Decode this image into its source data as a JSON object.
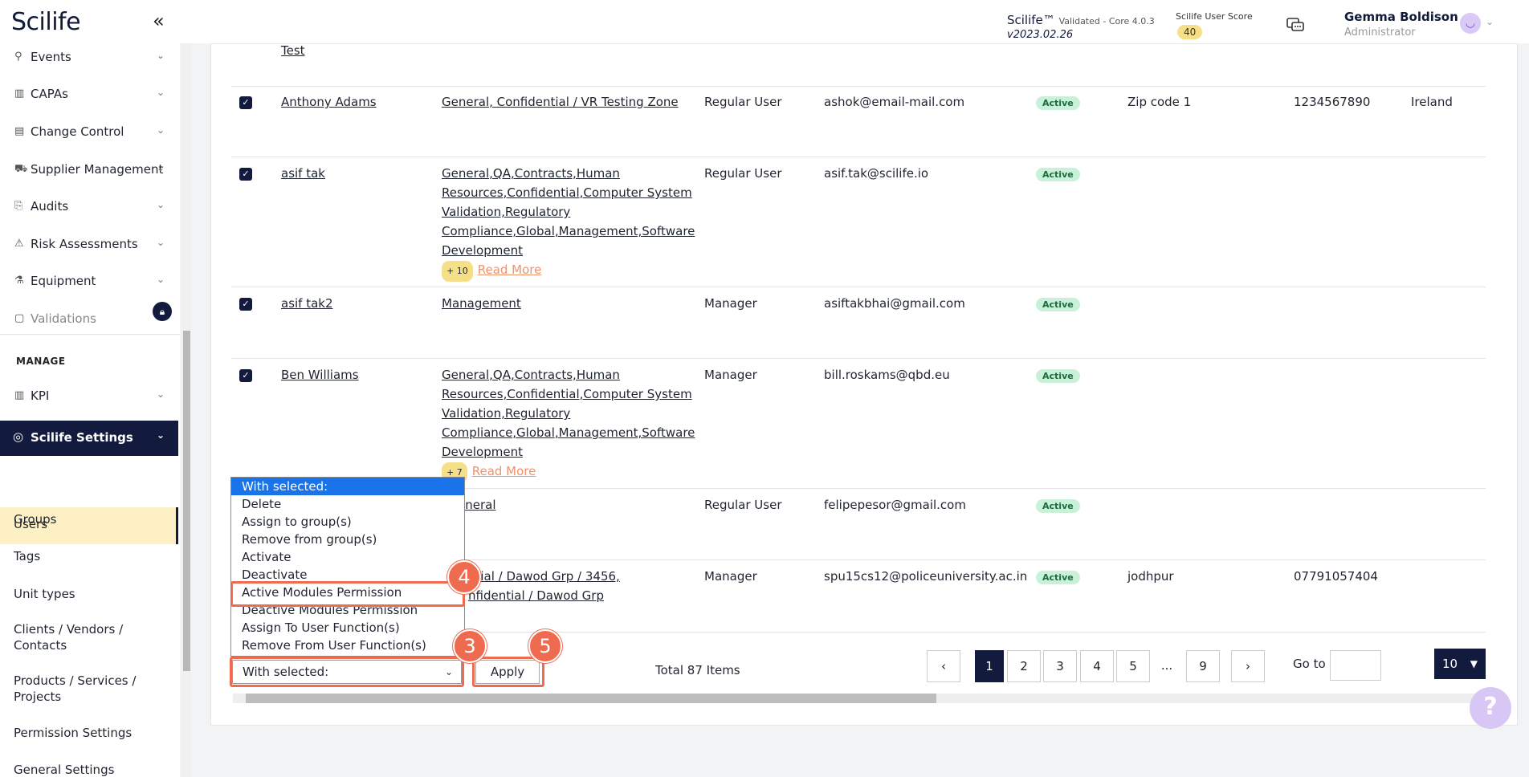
{
  "header": {
    "logo": "Scilife",
    "collapse_icon": "double-chevron-left",
    "product": "Scilife™",
    "validated": "Validated - Core 4.0.3",
    "version": "v2023.02.26",
    "score_label": "Scilife User Score",
    "score_value": "40",
    "user_name": "Gemma Boldison",
    "user_role": "Administrator"
  },
  "sidebar": {
    "items": [
      {
        "label": "Events",
        "icon": "pin"
      },
      {
        "label": "CAPAs",
        "icon": "chart"
      },
      {
        "label": "Change Control",
        "icon": "doc"
      },
      {
        "label": "Supplier Management",
        "icon": "truck"
      },
      {
        "label": "Audits",
        "icon": "audit"
      },
      {
        "label": "Risk Assessments",
        "icon": "warning"
      },
      {
        "label": "Equipment",
        "icon": "flask"
      },
      {
        "label": "Validations",
        "icon": "clipboard"
      }
    ],
    "manage_label": "MANAGE",
    "kpi_label": "KPI",
    "settings_label": "Scilife Settings",
    "sub_items": [
      "Users",
      "Groups",
      "Tags",
      "Unit types",
      "Clients / Vendors / Contacts",
      "Products / Services / Projects",
      "Permission Settings",
      "General Settings"
    ]
  },
  "table": {
    "top_cut": "Test",
    "rows": [
      {
        "name": "Anthony Adams",
        "groups": "General, Confidential / VR Testing Zone",
        "role": "Regular User",
        "email": "ashok@email-mail.com",
        "status": "Active",
        "zip": "Zip code 1",
        "phone": "1234567890",
        "country": "Ireland"
      },
      {
        "name": "asif tak",
        "groups_lines": [
          "General,QA,Contracts,Human",
          "Resources,Confidential,Computer System",
          "Validation,Regulatory",
          "Compliance,Global,Management,Software",
          "Development"
        ],
        "more": "+ 10",
        "read_more": "Read More",
        "role": "Regular User",
        "email": "asif.tak@scilife.io",
        "status": "Active"
      },
      {
        "name": "asif tak2",
        "groups": "Management",
        "role": "Manager",
        "email": "asiftakbhai@gmail.com",
        "status": "Active"
      },
      {
        "name": "Ben Williams",
        "groups_lines": [
          "General,QA,Contracts,Human",
          "Resources,Confidential,Computer System",
          "Validation,Regulatory",
          "Compliance,Global,Management,Software",
          "Development"
        ],
        "more": "+ 7",
        "read_more": "Read More",
        "role": "Manager",
        "email": "bill.roskams@qbd.eu",
        "status": "Active"
      },
      {
        "groups": "eneral",
        "role": "Regular User",
        "email": "felipepesor@gmail.com",
        "status": "Active"
      },
      {
        "groups_lines": [
          "ntial / Dawod Grp / 3456,",
          "nfidential / Dawod Grp"
        ],
        "role": "Manager",
        "email": "spu15cs12@policeuniversity.ac.in",
        "status": "Active",
        "zip": "jodhpur",
        "phone": "07791057404"
      }
    ]
  },
  "bulk": {
    "options": [
      "With selected:",
      "Delete",
      "Assign to group(s)",
      "Remove from group(s)",
      "Activate",
      "Deactivate",
      "Active Modules Permission",
      "Deactive Modules Permission",
      "Assign To User Function(s)",
      "Remove From User Function(s)"
    ],
    "select_value": "With selected:",
    "apply_label": "Apply",
    "steps": [
      "3",
      "4",
      "5"
    ]
  },
  "pagination": {
    "total": "Total 87 Items",
    "prev": "‹",
    "next": "›",
    "pages": [
      "1",
      "2",
      "3",
      "4",
      "5",
      "...",
      "9"
    ],
    "goto_label": "Go to",
    "page_size": "10"
  },
  "help_label": "?"
}
